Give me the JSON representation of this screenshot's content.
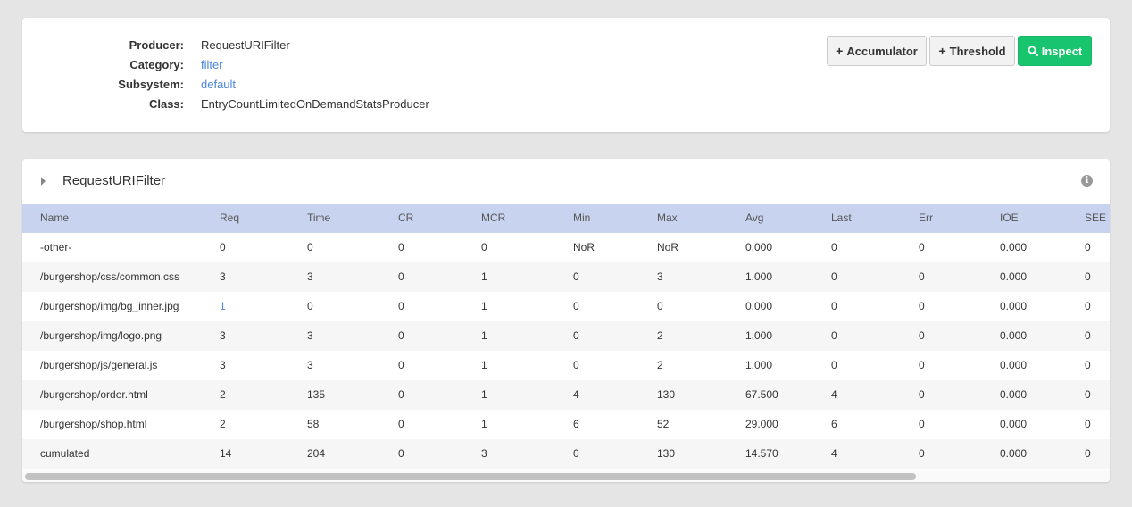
{
  "info": {
    "producer_label": "Producer:",
    "producer_value": "RequestURIFilter",
    "category_label": "Category:",
    "category_value": "filter",
    "subsystem_label": "Subsystem:",
    "subsystem_value": "default",
    "class_label": "Class:",
    "class_value": "EntryCountLimitedOnDemandStatsProducer"
  },
  "toolbar": {
    "accumulator_label": "Accumulator",
    "threshold_label": "Threshold",
    "inspect_label": "Inspect"
  },
  "panel": {
    "title": "RequestURIFilter"
  },
  "table": {
    "columns": [
      "Name",
      "Req",
      "Time",
      "CR",
      "MCR",
      "Min",
      "Max",
      "Avg",
      "Last",
      "Err",
      "IOE",
      "SEE"
    ],
    "rows": [
      [
        "-other-",
        "0",
        "0",
        "0",
        "0",
        "NoR",
        "NoR",
        "0.000",
        "0",
        "0",
        "0.000",
        "0"
      ],
      [
        "/burgershop/css/common.css",
        "3",
        "3",
        "0",
        "1",
        "0",
        "3",
        "1.000",
        "0",
        "0",
        "0.000",
        "0"
      ],
      [
        "/burgershop/img/bg_inner.jpg",
        "1",
        "0",
        "0",
        "1",
        "0",
        "0",
        "0.000",
        "0",
        "0",
        "0.000",
        "0"
      ],
      [
        "/burgershop/img/logo.png",
        "3",
        "3",
        "0",
        "1",
        "0",
        "2",
        "1.000",
        "0",
        "0",
        "0.000",
        "0"
      ],
      [
        "/burgershop/js/general.js",
        "3",
        "3",
        "0",
        "1",
        "0",
        "2",
        "1.000",
        "0",
        "0",
        "0.000",
        "0"
      ],
      [
        "/burgershop/order.html",
        "2",
        "135",
        "0",
        "1",
        "4",
        "130",
        "67.500",
        "4",
        "0",
        "0.000",
        "0"
      ],
      [
        "/burgershop/shop.html",
        "2",
        "58",
        "0",
        "1",
        "6",
        "52",
        "29.000",
        "6",
        "0",
        "0.000",
        "0"
      ],
      [
        "cumulated",
        "14",
        "204",
        "0",
        "3",
        "0",
        "130",
        "14.570",
        "4",
        "0",
        "0.000",
        "0"
      ]
    ]
  },
  "colors": {
    "accent_green": "#19c46e",
    "link_blue": "#4a86d6",
    "table_header": "#c8d4ef"
  },
  "icons": {
    "accumulator": "plus-icon",
    "threshold": "plus-icon",
    "inspect": "search-icon",
    "panel_toggle": "caret-right-icon",
    "panel_info": "info-circle-icon"
  }
}
